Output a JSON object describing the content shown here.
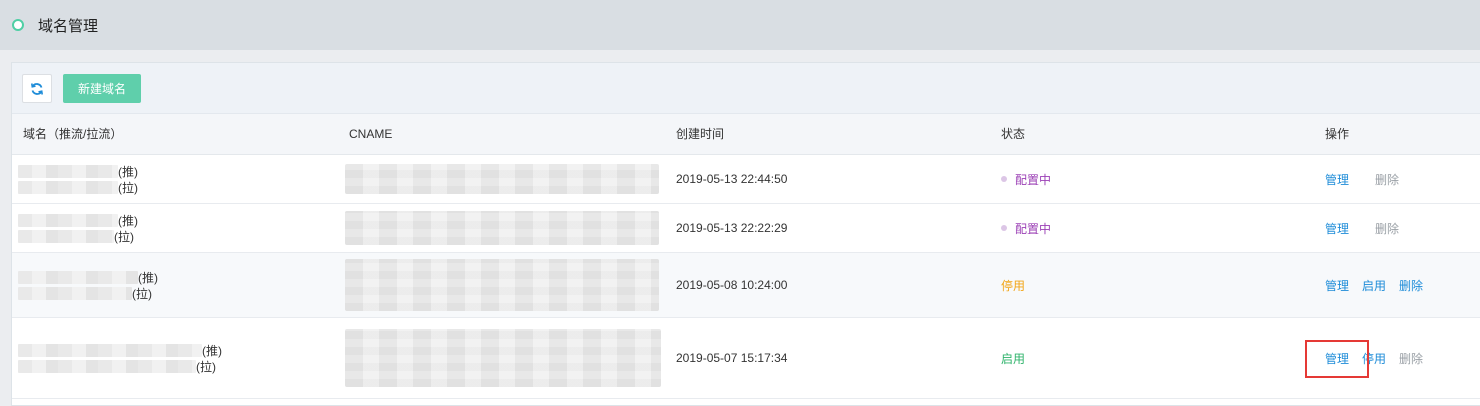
{
  "page": {
    "title": "域名管理"
  },
  "toolbar": {
    "refresh_icon": "refresh-icon",
    "new_domain_label": "新建域名"
  },
  "table": {
    "columns": [
      "域名（推流/拉流）",
      "CNAME",
      "创建时间",
      "状态",
      "操作"
    ],
    "rows": [
      {
        "push_tag": "(推)",
        "pull_tag": "(拉)",
        "created": "2019-05-13 22:44:50",
        "status": "配置中",
        "ops": [
          "管理",
          "删除"
        ]
      },
      {
        "push_tag": "(推)",
        "pull_tag": "(拉)",
        "created": "2019-05-13 22:22:29",
        "status": "配置中",
        "ops": [
          "管理",
          "删除"
        ]
      },
      {
        "push_tag": "(推)",
        "pull_tag": "(拉)",
        "created": "2019-05-08 10:24:00",
        "status": "停用",
        "ops": [
          "管理",
          "启用",
          "删除"
        ]
      },
      {
        "push_tag": "(推)",
        "pull_tag": "(拉)",
        "created": "2019-05-07 15:17:34",
        "status": "启用",
        "ops": [
          "管理",
          "停用",
          "删除"
        ]
      }
    ]
  },
  "colors": {
    "accent": "#5fcfab",
    "link": "#1e8cd8",
    "status_config": "#9b3fb5",
    "status_stop": "#f2a516",
    "status_on": "#2fb36b",
    "highlight": "#e53935"
  }
}
